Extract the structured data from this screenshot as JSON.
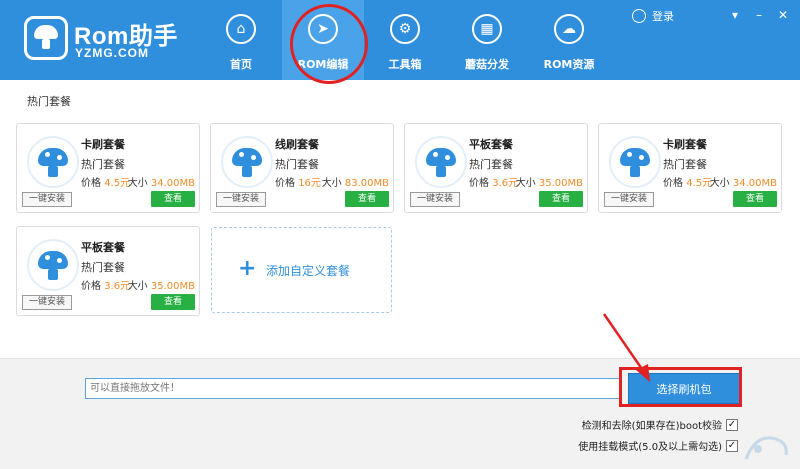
{
  "app": {
    "logo_title": "Rom助手",
    "logo_subtitle": "YZMG.COM"
  },
  "nav": [
    {
      "label": "首页",
      "icon": "home-icon"
    },
    {
      "label": "ROM编辑",
      "icon": "cursor-icon"
    },
    {
      "label": "工具箱",
      "icon": "gear-icon"
    },
    {
      "label": "蘑菇分发",
      "icon": "grid-icon"
    },
    {
      "label": "ROM资源",
      "icon": "cloud-icon"
    }
  ],
  "header_right": {
    "login_label": "登录"
  },
  "section_title": "热门套餐",
  "cards": [
    {
      "title": "卡刷套餐",
      "subtitle": "热门套餐",
      "price_label": "价格",
      "price": "4.5元",
      "size_label": "大小",
      "size": "34.00MB",
      "install_label": "一键安装",
      "view_label": "查看"
    },
    {
      "title": "线刷套餐",
      "subtitle": "热门套餐",
      "price_label": "价格",
      "price": "16元",
      "size_label": "大小",
      "size": "83.00MB",
      "install_label": "一键安装",
      "view_label": "查看"
    },
    {
      "title": "平板套餐",
      "subtitle": "热门套餐",
      "price_label": "价格",
      "price": "3.6元",
      "size_label": "大小",
      "size": "35.00MB",
      "install_label": "一键安装",
      "view_label": "查看"
    },
    {
      "title": "卡刷套餐",
      "subtitle": "热门套餐",
      "price_label": "价格",
      "price": "4.5元",
      "size_label": "大小",
      "size": "34.00MB",
      "install_label": "一键安装",
      "view_label": "查看"
    },
    {
      "title": "平板套餐",
      "subtitle": "热门套餐",
      "price_label": "价格",
      "price": "3.6元",
      "size_label": "大小",
      "size": "35.00MB",
      "install_label": "一键安装",
      "view_label": "查看"
    }
  ],
  "add_card": {
    "label": "添加自定义套餐"
  },
  "bottom": {
    "drop_placeholder": "可以直接拖放文件！",
    "select_button": "选择刷机包",
    "options": [
      {
        "label": "检测和去除(如果存在)boot校验",
        "checked": true
      },
      {
        "label": "使用挂载模式(5.0及以上需勾选)",
        "checked": true
      }
    ]
  },
  "colors": {
    "header_bg": "#2f8fdc",
    "accent_green": "#28b045",
    "price_orange": "#f08c28",
    "annotation_red": "#e02222"
  }
}
